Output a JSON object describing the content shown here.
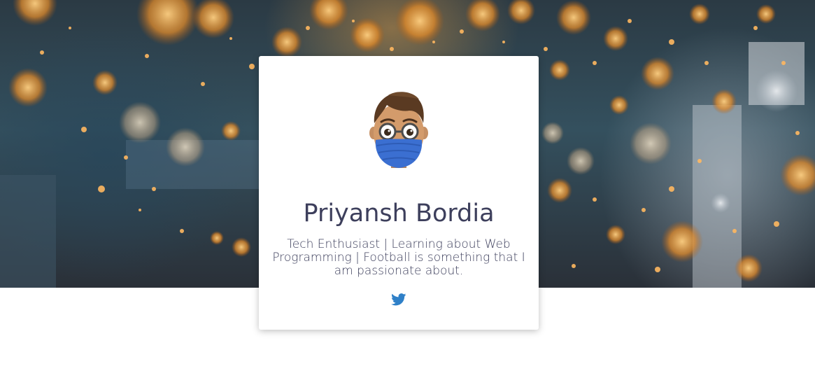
{
  "profile": {
    "name": "Priyansh Bordia",
    "bio": "Tech Enthusiast | Learning about Web Programming | Football is something that I am passionate about."
  },
  "social": {
    "twitter_icon": "twitter-icon",
    "twitter_color": "#2f80c8"
  },
  "colors": {
    "text": "#3d3f5c",
    "card_bg": "#ffffff",
    "mask": "#3b6fd1"
  },
  "hero": {
    "background_icon": "bokeh-sparks-background"
  },
  "avatar": {
    "icon": "memoji-avatar-icon"
  }
}
